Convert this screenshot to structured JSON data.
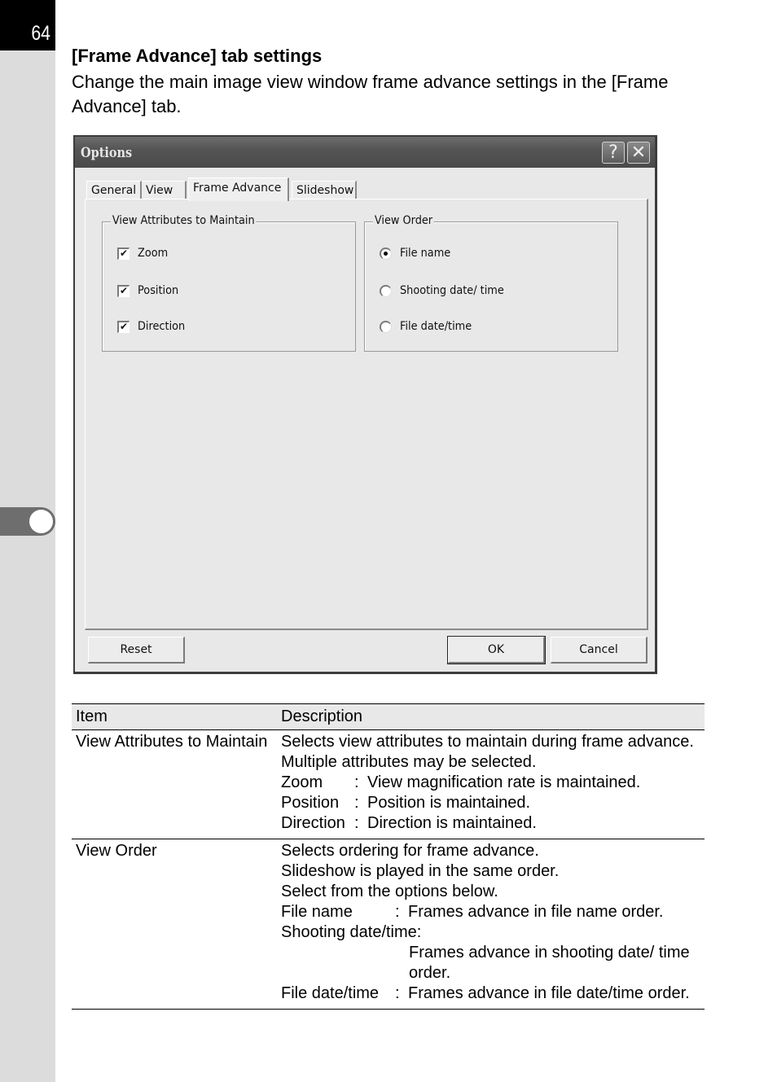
{
  "page": {
    "number": "64",
    "heading": "[Frame Advance] tab settings",
    "intro": "Change the main image view window frame advance settings in the [Frame Advance] tab."
  },
  "dialog": {
    "title": "Options",
    "help_button": "?",
    "close_button": "✕",
    "tabs": [
      {
        "label": "General",
        "active": false
      },
      {
        "label": "View",
        "active": false
      },
      {
        "label": "Frame Advance",
        "active": true
      },
      {
        "label": "Slideshow",
        "active": false
      }
    ],
    "attributes_group": {
      "legend": "View Attributes to Maintain",
      "options": [
        {
          "label": "Zoom",
          "checked": true
        },
        {
          "label": "Position",
          "checked": true
        },
        {
          "label": "Direction",
          "checked": true
        }
      ]
    },
    "order_group": {
      "legend": "View Order",
      "options": [
        {
          "label": "File name",
          "selected": true
        },
        {
          "label": "Shooting date/ time",
          "selected": false
        },
        {
          "label": "File date/time",
          "selected": false
        }
      ]
    },
    "buttons": {
      "reset": "Reset",
      "ok": "OK",
      "cancel": "Cancel"
    },
    "check_mark": "✔"
  },
  "table": {
    "headers": [
      "Item",
      "Description"
    ],
    "rows": [
      {
        "item": "View Attributes to Maintain",
        "lines": [
          "Selects view attributes to maintain during frame advance. Multiple attributes may be selected."
        ],
        "pairs": [
          {
            "key": "Zoom",
            "sep": ":",
            "value": "View magnification rate is maintained."
          },
          {
            "key": "Position",
            "sep": ":",
            "value": "Position is maintained."
          },
          {
            "key": "Direction",
            "sep": ":",
            "value": "Direction is maintained."
          }
        ]
      },
      {
        "item": "View Order",
        "lines": [
          "Selects ordering for frame advance.",
          "Slideshow is played in the same order.",
          "Select from the options below."
        ],
        "pairs": [
          {
            "key": "File name",
            "sep": ":",
            "value": "Frames advance in file name order."
          },
          {
            "key": "Shooting date/time:",
            "sep": "",
            "value": ""
          },
          {
            "key": "",
            "sep": "",
            "value": "Frames advance in shooting date/ time order."
          },
          {
            "key": "File date/time",
            "sep": ":",
            "value": "Frames advance in file date/time order."
          }
        ]
      }
    ]
  }
}
